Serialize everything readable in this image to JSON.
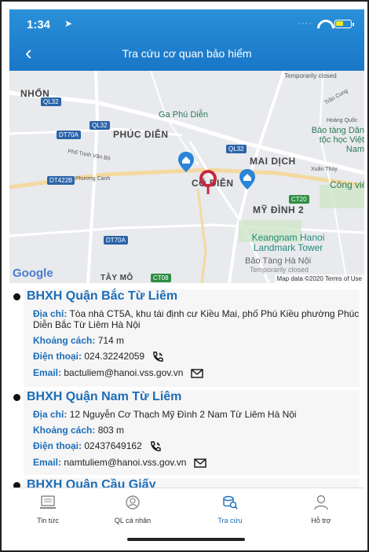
{
  "status_bar": {
    "time": "1:34",
    "location_arrow": "location-arrow-icon"
  },
  "header": {
    "title": "Tra cứu cơ quan bảo hiểm",
    "back_icon": "back-chevron-icon"
  },
  "map": {
    "labels": {
      "nhon": "NHỔN",
      "ga_phu_dien": "Ga Phú Diễn",
      "phuc_dien": "PHÚC DIỄN",
      "mai_dich": "MAI DỊCH",
      "bao_tang_dan_toc": "Bảo tàng Dân tộc học Việt Nam",
      "cong_vien": "Công viên",
      "my_dinh_2": "MỸ ĐÌNH 2",
      "keangnam": "Keangnam Hanoi Landmark Tower",
      "bao_tang_ha_noi": "Bảo Tàng Hà Nội",
      "temporarily_closed_top": "Temporarily closed",
      "temporarily_closed": "Temporarily closed",
      "tay_mo": "TÂY MỖ",
      "co_dien": "CỔ DIỄN",
      "pho_trinh_van_bo": "Phố Trịnh Văn Bô",
      "phuong_canh": "Phương Canh",
      "hoang_quoc": "Hoàng Quốc",
      "tran_cung": "Trần Cung",
      "xuan_thuy": "Xuân Thủy"
    },
    "road_tags": [
      "QL32",
      "QL32",
      "DT70A",
      "QL32",
      "DT422B",
      "CT20",
      "DT70A",
      "CT08"
    ],
    "google": "Google",
    "attribution": "Map data ©2020   Terms of Use"
  },
  "offices": [
    {
      "name": "BHXH Quận Bắc Từ Liêm",
      "address_label": "Địa chỉ:",
      "address": "Tòa nhà CT5A, khu tái định cư Kiều Mai, phố Phú Kiều phường Phúc Diễn Bắc Từ Liêm Hà Nội",
      "distance_label": "Khoảng cách:",
      "distance": "714 m",
      "phone_label": "Điện thoại:",
      "phone": "024.32242059",
      "email_label": "Email:",
      "email": "bactuliem@hanoi.vss.gov.vn"
    },
    {
      "name": "BHXH Quận Nam Từ Liêm",
      "address_label": "Địa chỉ:",
      "address": "12 Nguyễn Cơ Thạch Mỹ Đình 2 Nam Từ Liêm Hà Nội",
      "distance_label": "Khoảng cách:",
      "distance": "803 m",
      "phone_label": "Điện thoại:",
      "phone": "02437649162",
      "email_label": "Email:",
      "email": "namtuliem@hanoi.vss.gov.vn"
    },
    {
      "name": "BHXH Quận Cầu Giấy"
    }
  ],
  "tabs": [
    {
      "label": "Tin tức",
      "icon": "news-icon"
    },
    {
      "label": "QL cá nhân",
      "icon": "personal-icon"
    },
    {
      "label": "Tra cứu",
      "icon": "lookup-icon",
      "active": true
    },
    {
      "label": "Hỗ trợ",
      "icon": "support-icon"
    }
  ],
  "colors": {
    "header": "#1976c8",
    "accent": "#1c6db8",
    "pin": "#c8283c",
    "marker": "#2a84d8"
  }
}
